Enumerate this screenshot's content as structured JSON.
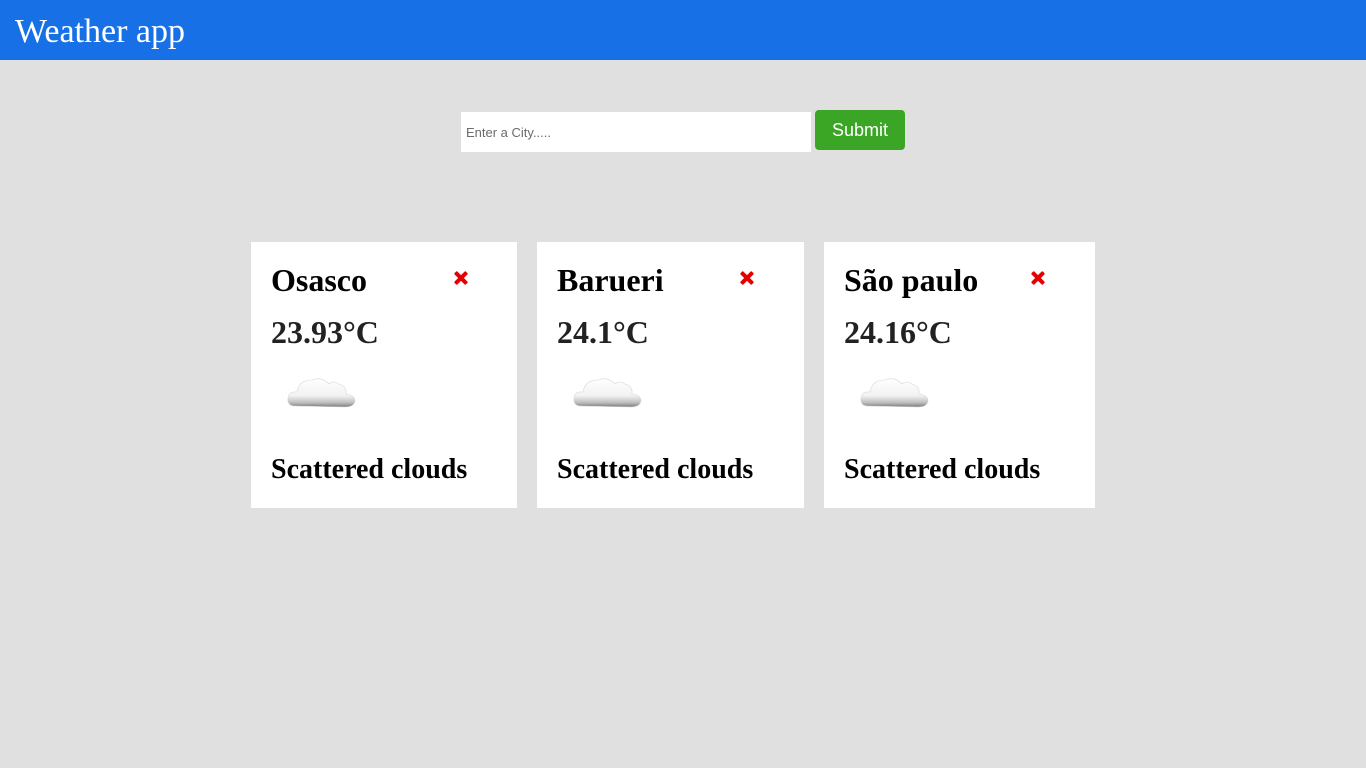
{
  "header": {
    "title": "Weather app"
  },
  "search": {
    "placeholder": "Enter a City.....",
    "value": "",
    "submit_label": "Submit"
  },
  "cards": [
    {
      "city": "Osasco",
      "temperature": "23.93°C",
      "description": "Scattered clouds",
      "icon": "cloud-icon",
      "close_icon": "close-icon"
    },
    {
      "city": "Barueri",
      "temperature": "24.1°C",
      "description": "Scattered clouds",
      "icon": "cloud-icon",
      "close_icon": "close-icon"
    },
    {
      "city": "São paulo",
      "temperature": "24.16°C",
      "description": "Scattered clouds",
      "icon": "cloud-icon",
      "close_icon": "close-icon"
    }
  ],
  "colors": {
    "header": "#1770e6",
    "background": "#e0e0e0",
    "submit": "#3ba525",
    "close": "#e60000",
    "card": "#ffffff"
  }
}
